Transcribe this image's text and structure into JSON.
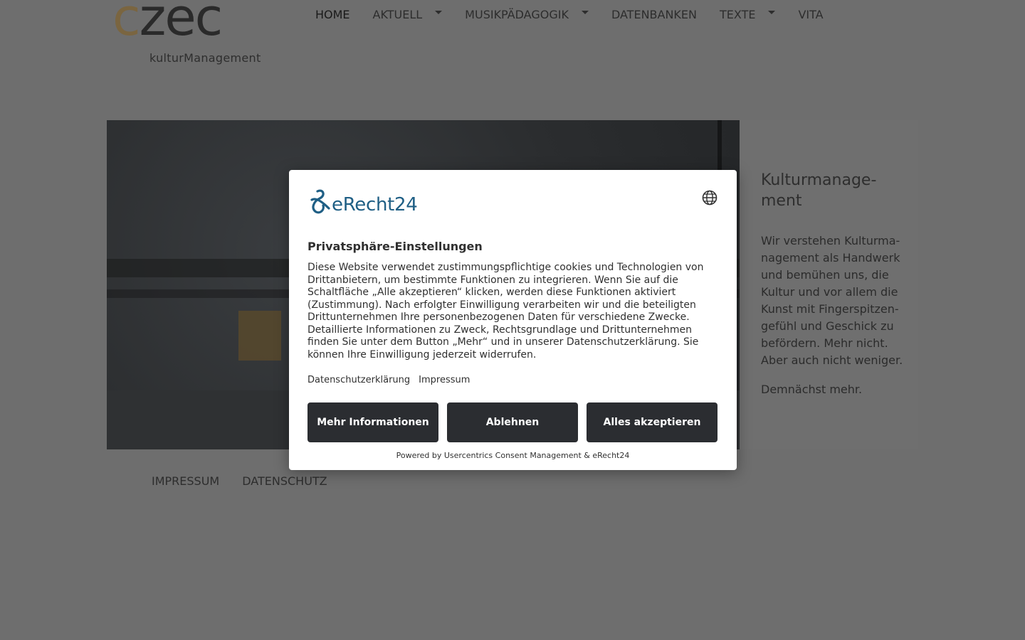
{
  "site": {
    "logo_word_c": "c",
    "logo_word_rest": "zec",
    "logo_sub": "kulturManagement"
  },
  "nav": {
    "items": [
      {
        "label": "HOME",
        "dropdown": false
      },
      {
        "label": "AKTUELL",
        "dropdown": true
      },
      {
        "label": "MUSIKPÄDAGOGIK",
        "dropdown": true
      },
      {
        "label": "DATENBANKEN",
        "dropdown": false
      },
      {
        "label": "TEXTE",
        "dropdown": true
      },
      {
        "label": "VITA",
        "dropdown": false
      }
    ]
  },
  "sidebar": {
    "title": "Kulturmanage-ment",
    "text": "Wir verstehen Kulturma-nagement als Handwerk und bemühen uns, die Kultur und vor allem die Kunst mit Fingerspitzen-gefühl und Geschick zu befördern. Mehr nicht. Aber auch nicht weniger.",
    "more": "Demnächst mehr."
  },
  "footer": {
    "links": [
      "IMPRESSUM",
      "DATENSCHUTZ"
    ]
  },
  "consent": {
    "brand": "eRecht24",
    "brand_icon": "erecht24-logo-icon",
    "language_icon": "globe-icon",
    "title": "Privatsphäre-Einstellungen",
    "body": "Diese Website verwendet zustimmungspflichtige cookies und Technologien von Drittanbietern, um bestimmte Funktionen zu integrieren. Wenn Sie auf die Schaltfläche „Alle akzeptieren“ klicken, werden diese Funktionen aktiviert (Zustimmung). Nach erfolgter Einwilligung verarbeiten wir und die beteiligten Drittunternehmen Ihre personenbezogenen Daten für verschiedene Zwecke. Detaillierte Informationen zu Zweck, Rechtsgrundlage und Drittunternehmen finden Sie unter dem Button „Mehr“ und in unserer Datenschutzerklärung. Sie können Ihre Einwilligung jederzeit widerrufen.",
    "links": {
      "privacy": "Datenschutzerklärung",
      "imprint": "Impressum"
    },
    "buttons": {
      "more": "Mehr Informationen",
      "deny": "Ablehnen",
      "accept": "Alles akzeptieren"
    },
    "powered_by": "Powered by Usercentrics Consent Management & eRecht24",
    "colors": {
      "brand": "#1f5f85",
      "button_bg": "#2b2d31"
    }
  }
}
